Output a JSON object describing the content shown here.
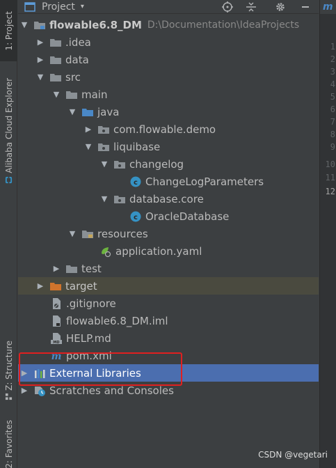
{
  "header": {
    "title": "Project",
    "dropdown": "▾"
  },
  "left_strip": {
    "project_tab": "1: Project",
    "alibaba_tab": "Alibaba Cloud Explorer",
    "structure_tab": "Z: Structure",
    "favorites_tab": "2: Favorites"
  },
  "tree": {
    "root": {
      "label": "flowable6.8_DM",
      "path": "D:\\Documentation\\IdeaProjects"
    },
    "idea": ".idea",
    "data": "data",
    "src": "src",
    "main": "main",
    "java": "java",
    "pkg_demo": "com.flowable.demo",
    "liquibase": "liquibase",
    "changelog": "changelog",
    "changelog_class": "ChangeLogParameters",
    "database_core": "database.core",
    "oracle_class": "OracleDatabase",
    "resources": "resources",
    "app_yaml": "application.yaml",
    "test": "test",
    "target": "target",
    "gitignore": ".gitignore",
    "iml": "flowable6.8_DM.iml",
    "help": "HELP.md",
    "pom": "pom.xml",
    "external_libraries": "External Libraries",
    "scratches": "Scratches and Consoles"
  },
  "gutter": {
    "top_glyph": "m",
    "lines": [
      "1",
      "2",
      "3",
      "4",
      "5",
      "6",
      "7",
      "8",
      "9",
      "10",
      "11",
      "12"
    ]
  },
  "watermark": "CSDN @vegetari",
  "colors": {
    "folder": "#8a9095",
    "source_folder": "#4a88c7",
    "target_folder": "#d0742c",
    "class_icon": "#3592c4",
    "selection": "#4b6eaf",
    "annotation": "#e02020"
  }
}
